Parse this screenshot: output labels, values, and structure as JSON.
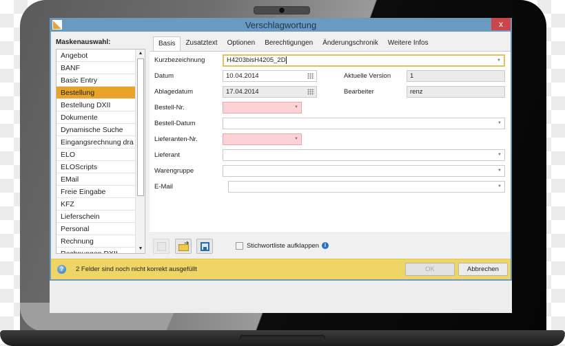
{
  "window": {
    "title": "Verschlagwortung",
    "close_label": "x"
  },
  "mask_panel": {
    "label": "Maskenauswahl:",
    "selected_index": 3,
    "items": [
      "Angebot",
      "BANF",
      "Basic Entry",
      "Bestellung",
      "Bestellung DXII",
      "Dokumente",
      "Dynamische Suche",
      "Eingangsrechnung dra",
      "ELO",
      "ELOScripts",
      "EMail",
      "Freie Eingabe",
      "KFZ",
      "Lieferschein",
      "Personal",
      "Rechnung",
      "Rechnungen DXII"
    ],
    "scroll_up": "▲",
    "scroll_down": "▼"
  },
  "tabs": [
    {
      "label": "Basis",
      "active": true
    },
    {
      "label": "Zusatztext",
      "active": false
    },
    {
      "label": "Optionen",
      "active": false
    },
    {
      "label": "Berechtigungen",
      "active": false
    },
    {
      "label": "Änderungschronik",
      "active": false
    },
    {
      "label": "Weitere Infos",
      "active": false
    }
  ],
  "form": {
    "kurzbezeichnung": {
      "label": "Kurzbezeichnung",
      "value": "H4203bisH4205_2D"
    },
    "datum": {
      "label": "Datum",
      "value": "10.04.2014"
    },
    "ablagedatum": {
      "label": "Ablagedatum",
      "value": "17.04.2014"
    },
    "aktuelle_version": {
      "label": "Aktuelle Version",
      "value": "1"
    },
    "bearbeiter": {
      "label": "Bearbeiter",
      "value": "renz"
    },
    "bestell_nr": {
      "label": "Bestell-Nr.",
      "value": ""
    },
    "bestell_datum": {
      "label": "Bestell-Datum",
      "value": ""
    },
    "lieferanten_nr": {
      "label": "Lieferanten-Nr.",
      "value": ""
    },
    "lieferant": {
      "label": "Lieferant",
      "value": ""
    },
    "warengruppe": {
      "label": "Warengruppe",
      "value": ""
    },
    "email": {
      "label": "E-Mail",
      "value": ""
    }
  },
  "toolbar": {
    "checkbox_label": "Stichwortliste aufklappen",
    "checkbox_checked": false,
    "info": "i"
  },
  "status": {
    "help": "?",
    "message": "2 Felder sind noch nicht korrekt ausgefüllt",
    "ok_label": "OK",
    "cancel_label": "Abbrechen"
  },
  "colors": {
    "titlebar": "#6a9ac0",
    "selection": "#e9a32a",
    "required_field": "#fdd2d4",
    "statusbar": "#eed565",
    "close": "#c9474a"
  }
}
